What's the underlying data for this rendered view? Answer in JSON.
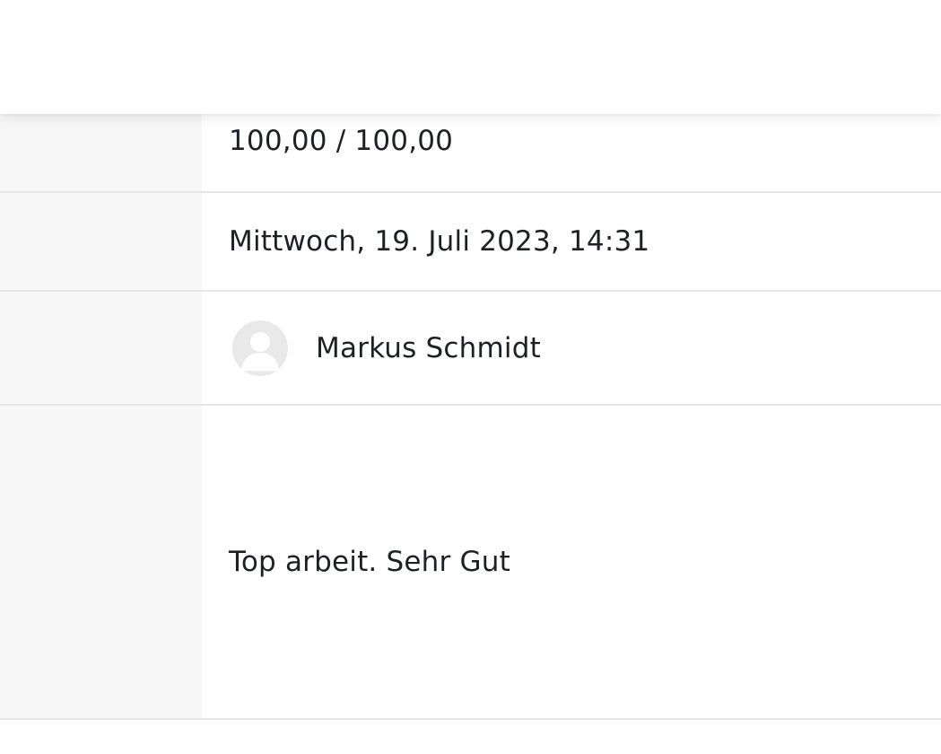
{
  "grade_summary": {
    "grade": "100,00 / 100,00",
    "graded_on": "Mittwoch, 19. Juli 2023, 14:31",
    "grader": {
      "name": "Markus Schmidt",
      "avatar_icon": "default-user-avatar-icon"
    },
    "feedback": "Top arbeit. Sehr Gut"
  },
  "colors": {
    "label_column_bg": "#f7f7f7",
    "row_border": "#e6e6e6",
    "text": "#1d2125",
    "avatar_bg": "#e9e9e9"
  }
}
